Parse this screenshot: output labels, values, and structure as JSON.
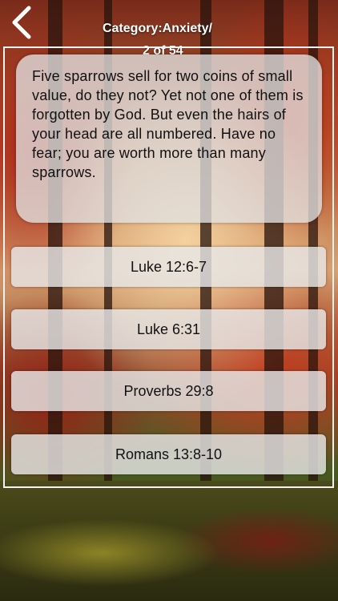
{
  "header": {
    "category_line": "Category:Anxiety/",
    "progress_line": "2 of 54",
    "back_icon": "chevron-left-icon"
  },
  "question": {
    "text": "Five sparrows sell for two coins of small value, do they not? Yet not one of them is forgotten by God. But even the hairs of your head are all numbered. Have no fear; you are worth more than many sparrows."
  },
  "options": [
    {
      "label": "Luke 12:6-7"
    },
    {
      "label": "Luke 6:31"
    },
    {
      "label": "Proverbs 29:8"
    },
    {
      "label": "Romans 13:8-10"
    }
  ],
  "colors": {
    "frame": "#f2f2f2",
    "panel": "#e1e1e1",
    "text": "#111111"
  }
}
